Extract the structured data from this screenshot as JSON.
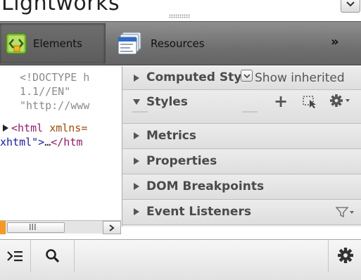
{
  "window": {
    "title": "Lightworks"
  },
  "toolbar": {
    "elements_label": "Elements",
    "resources_label": "Resources",
    "more_label": "»"
  },
  "dom": {
    "lines": [
      "<!DOCTYPE h",
      "1.1//EN\"",
      "\"http://www",
      "<html xmlns=",
      "xhtml\">…</htm"
    ],
    "doctype_l1": "<!DOCTYPE h",
    "doctype_l2": "1.1//EN\"",
    "doctype_l3": "\"http://www",
    "html_open_tag": "<html",
    "html_attr": "xmlns=",
    "html_value_tail": "xhtml\">",
    "html_ellipsis": "…",
    "html_close": "</htm"
  },
  "sidebar": {
    "computed_style": {
      "label": "Computed Sty",
      "show_inherited": "Show inherited"
    },
    "styles": {
      "label": "Styles"
    },
    "metrics": {
      "label": "Metrics"
    },
    "properties": {
      "label": "Properties"
    },
    "dom_breakpoints": {
      "label": "DOM Breakpoints"
    },
    "event_listeners": {
      "label": "Event Listeners"
    }
  },
  "scrollbar": {
    "thumb_grip": "III"
  },
  "colors": {
    "toolbar": "#707070",
    "sidebar_bg": "#e9e9e9",
    "tag": "#8e1b6b",
    "attr": "#9c4a08",
    "value": "#1a1aa6",
    "scroll_accent": "#f39a26"
  },
  "icons": {
    "elements": "elements-icon",
    "resources": "resources-icon",
    "console": "console-icon",
    "search": "search-icon",
    "settings": "gear-icon",
    "filter": "filter-icon"
  }
}
